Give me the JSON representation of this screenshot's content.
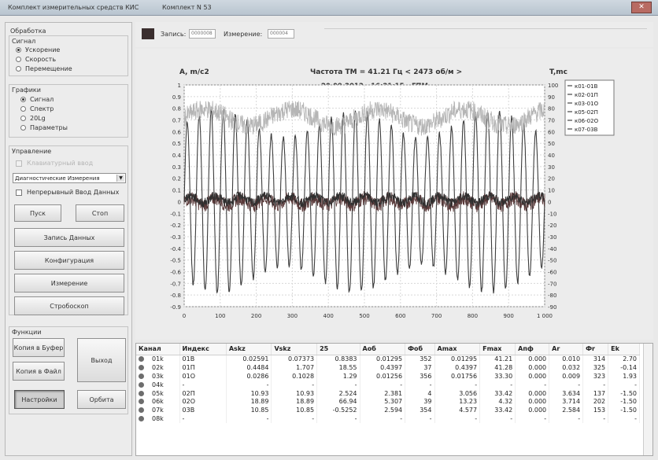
{
  "window": {
    "title": "Комплект измерительных средств КИС",
    "kit": "Комплект N 53",
    "close_glyph": "✕"
  },
  "left": {
    "processing_title": "Обработка",
    "signal_title": "Сигнал",
    "signal_options": [
      "Ускорение",
      "Скорость",
      "Перемещение"
    ],
    "signal_selected": 0,
    "graphs_title": "Графики",
    "graph_options": [
      "Сигнал",
      "Спектр",
      "20Lg",
      "Параметры"
    ],
    "graph_selected": 0,
    "control_title": "Управление",
    "control_check_disabled": "Клавиатурный ввод",
    "mode_select_value": "Диагностические Измерения",
    "continuous_input": "Непрерывный Ввод Данных",
    "start_button": "Пуск",
    "stop_button": "Стоп",
    "record_button": "Запись Данных",
    "config_button": "Конфигурация",
    "measure_button": "Измерение",
    "stroboscope_button": "Стробоскоп",
    "functions_title": "Функции",
    "copy_buffer_button": "Копия в Буфер",
    "copy_file_button": "Копия в Файл",
    "exit_button": "Выход",
    "settings_button": "Настройки",
    "orbit_button": "Орбита"
  },
  "topbar": {
    "record_label": "Запись:",
    "record_value": "0000008",
    "measure_label": "Измерение:",
    "measure_value": "000004"
  },
  "chart_data": {
    "type": "line",
    "title": "Частота ТМ =   41.21 Гц  <  2473 об/м >",
    "subtitle": "20.09.2013 - 16:21:15 - ГПМ",
    "ylabel_left": "А, m/c2",
    "ylabel_right": "T,mc",
    "xlim": [
      0,
      1000
    ],
    "ylim_left": [
      -0.9,
      1.0
    ],
    "ylim_right": [
      -90,
      100
    ],
    "x_ticks": [
      "0",
      "100",
      "200",
      "300",
      "400",
      "500",
      "600",
      "700",
      "800",
      "900",
      "1 000"
    ],
    "y_ticks_left": [
      "1",
      "0.9",
      "0.8",
      "0.7",
      "0.6",
      "0.5",
      "0.4",
      "0.3",
      "0.2",
      "0.1",
      "0",
      "-0.1",
      "-0.2",
      "-0.3",
      "-0.4",
      "-0.5",
      "-0.6",
      "-0.7",
      "-0.8",
      "-0.9"
    ],
    "y_ticks_right": [
      "100",
      "90",
      "80",
      "70",
      "60",
      "50",
      "40",
      "30",
      "20",
      "10",
      "0",
      "-10",
      "-20",
      "-30",
      "-40",
      "-50",
      "-60",
      "-70",
      "-80",
      "-90"
    ],
    "grid": true,
    "legend_position": "top-right",
    "legend": [
      "к01-01В",
      "к02-01П",
      "к03-01О",
      "к05-02П",
      "к06-02О",
      "к07-03В"
    ],
    "series": [
      {
        "name": "к01-01В",
        "kind": "periodic",
        "amplitude": 0.78,
        "cycles": 30,
        "offset": 0.0
      },
      {
        "name": "к02-01П",
        "kind": "noise",
        "amplitude": 0.06,
        "offset": 0.0
      },
      {
        "name": "к03-01О",
        "kind": "slow",
        "amplitude": 0.12,
        "offset": 0.72
      },
      {
        "name": "к05-02П",
        "kind": "noise",
        "amplitude": 0.04,
        "offset": 0.02
      }
    ],
    "colors": {
      "main": "#4a4a4a",
      "light": "#b8b8b8",
      "dark": "#3a3030",
      "grid": "#d8d8d8"
    }
  },
  "table": {
    "headers": [
      "Канал",
      "Индекс",
      "Askz",
      "Vskz",
      "25",
      "Aоб",
      "Фоб",
      "Amax",
      "Fmax",
      "Aпф",
      "Ar",
      "Фr",
      "Ek"
    ],
    "rows": [
      [
        "01k",
        "01B",
        "0.02591",
        "0.07373",
        "0.8383",
        "0.01295",
        "352",
        "0.01295",
        "41.21",
        "0.000",
        "0.010",
        "314",
        "2.70"
      ],
      [
        "02k",
        "01П",
        "0.4484",
        "1.707",
        "18.55",
        "0.4397",
        "37",
        "0.4397",
        "41.28",
        "0.000",
        "0.032",
        "325",
        "-0.14"
      ],
      [
        "03k",
        "01O",
        "0.0286",
        "0.1028",
        "1.29",
        "0.01256",
        "356",
        "0.01756",
        "33.30",
        "0.000",
        "0.009",
        "323",
        "1.93"
      ],
      [
        "04k",
        "-",
        "-",
        "-",
        "-",
        "-",
        "-",
        "-",
        "-",
        "-",
        "-",
        "-",
        "-"
      ],
      [
        "05k",
        "02П",
        "10.93",
        "10.93",
        "2.524",
        "2.381",
        "4",
        "3.056",
        "33.42",
        "0.000",
        "3.634",
        "137",
        "-1.50"
      ],
      [
        "06k",
        "02O",
        "18.89",
        "18.89",
        "66.94",
        "5.307",
        "39",
        "13.23",
        "4.32",
        "0.000",
        "3.714",
        "202",
        "-1.50"
      ],
      [
        "07k",
        "03B",
        "10.85",
        "10.85",
        "-0.5252",
        "2.594",
        "354",
        "4.577",
        "33.42",
        "0.000",
        "2.584",
        "153",
        "-1.50"
      ],
      [
        "08k",
        "-",
        "-",
        "-",
        "-",
        "-",
        "-",
        "-",
        "-",
        "-",
        "-",
        "-",
        "-"
      ]
    ]
  }
}
